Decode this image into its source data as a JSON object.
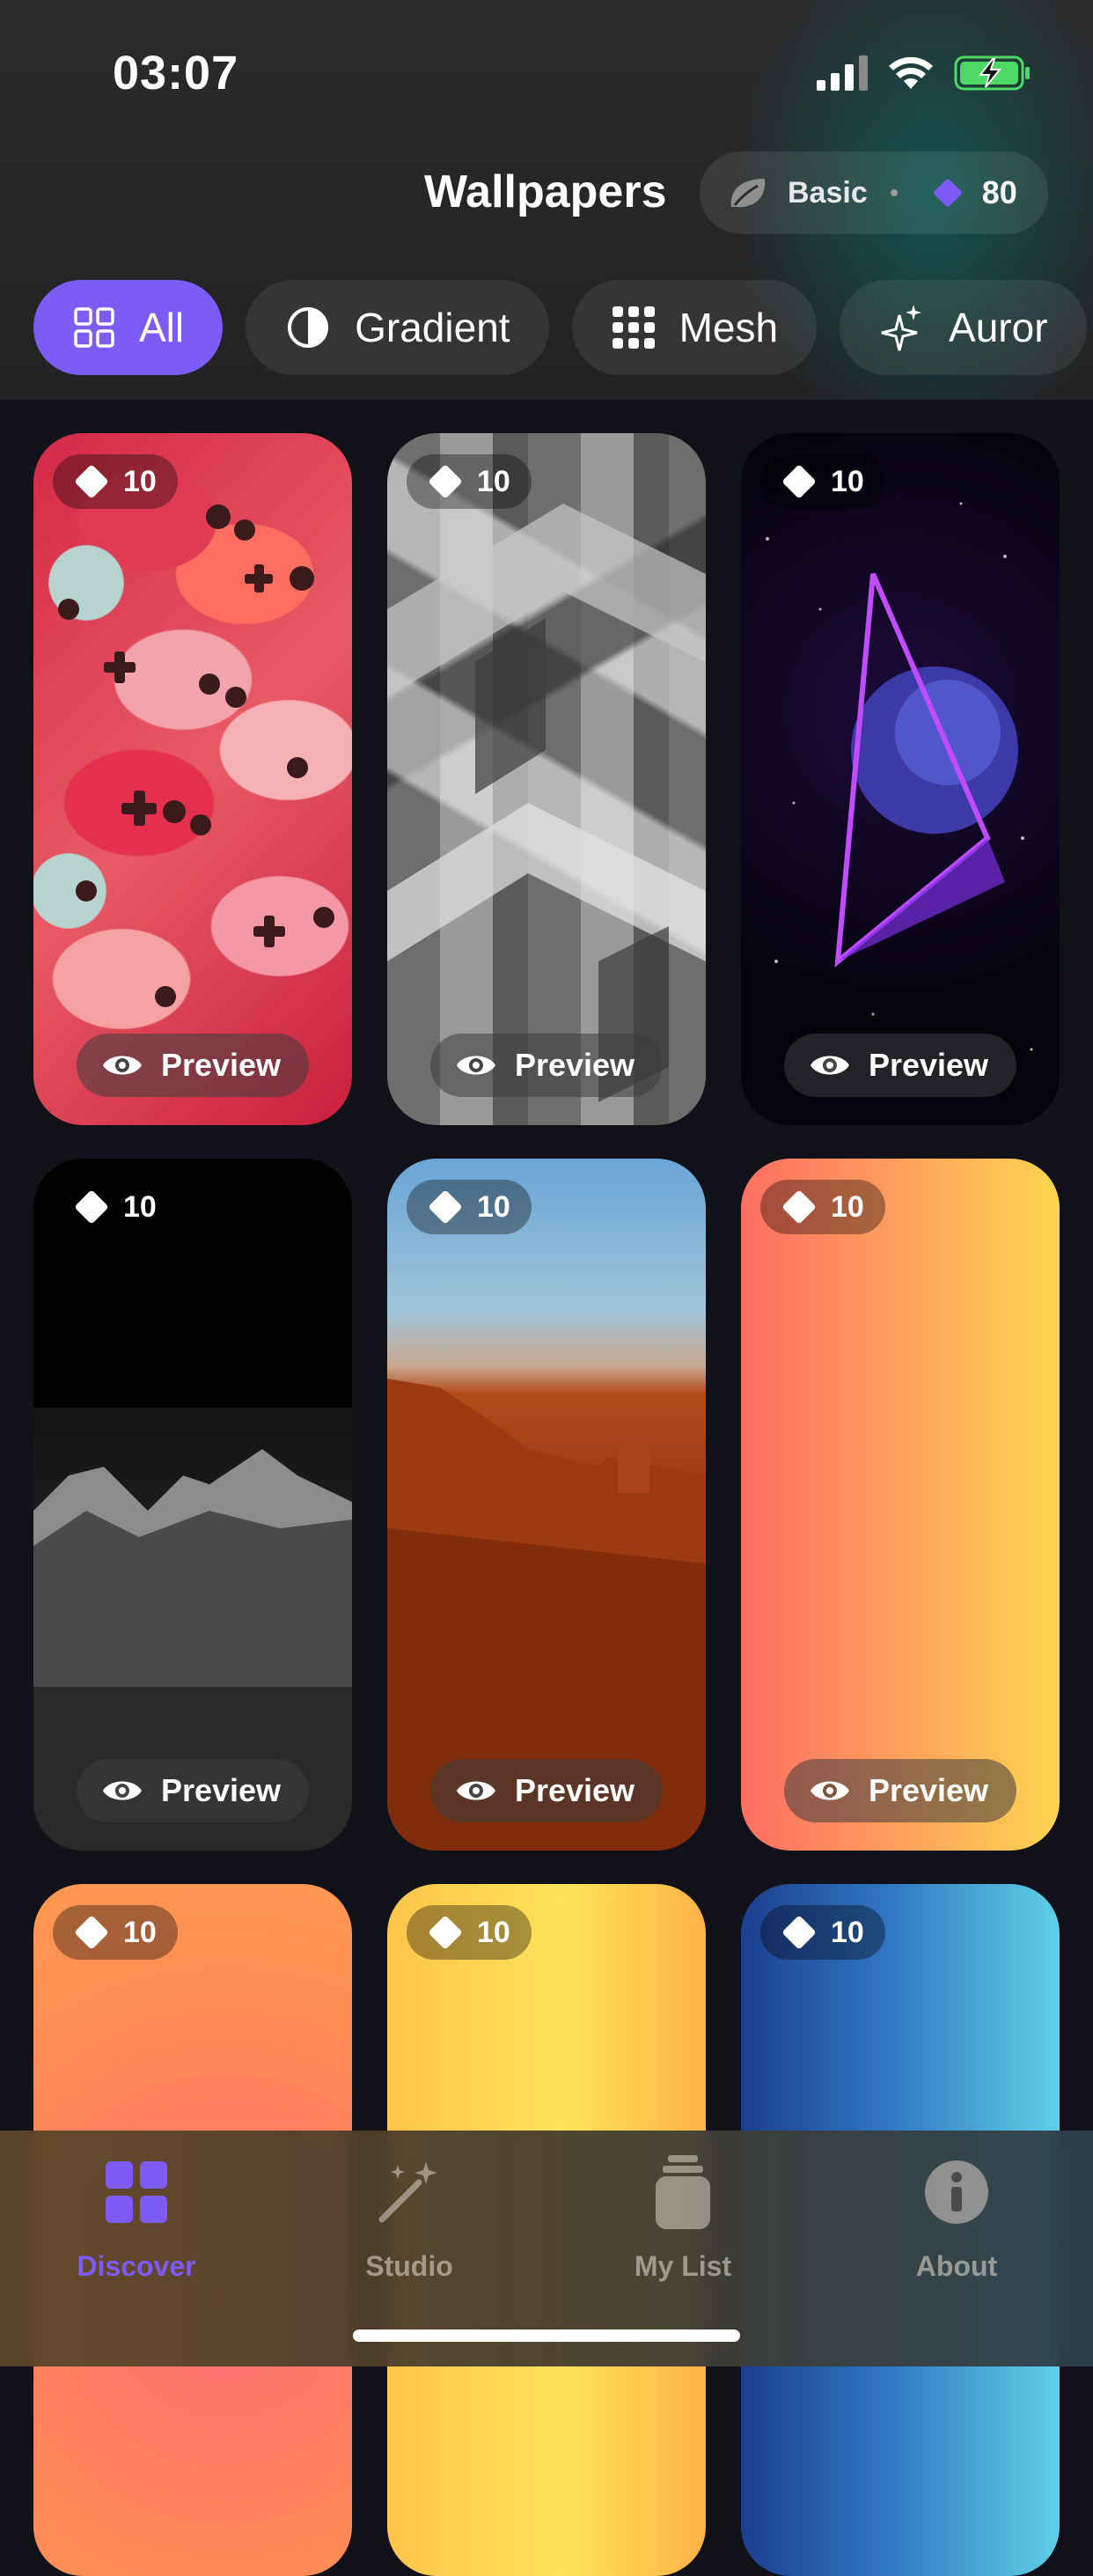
{
  "status_bar": {
    "time": "03:07"
  },
  "header": {
    "title": "Wallpapers",
    "plan": {
      "label": "Basic",
      "credits": "80"
    }
  },
  "filters": [
    {
      "label": "All",
      "icon": "grid-icon",
      "active": true
    },
    {
      "label": "Gradient",
      "icon": "half-circle-icon",
      "active": false
    },
    {
      "label": "Mesh",
      "icon": "dots-grid-icon",
      "active": false
    },
    {
      "label": "Auror",
      "icon": "sparkle-icon",
      "active": false
    }
  ],
  "cards": [
    {
      "price": "10",
      "preview_label": "Preview",
      "theme": "controllers"
    },
    {
      "price": "10",
      "preview_label": "Preview",
      "theme": "concrete"
    },
    {
      "price": "10",
      "preview_label": "Preview",
      "theme": "space"
    },
    {
      "price": "10",
      "preview_label": "Preview",
      "theme": "mountain"
    },
    {
      "price": "10",
      "preview_label": "Preview",
      "theme": "canyon"
    },
    {
      "price": "10",
      "preview_label": "Preview",
      "theme": "peach"
    },
    {
      "price": "10",
      "theme": "orange"
    },
    {
      "price": "10",
      "theme": "yellow"
    },
    {
      "price": "10",
      "theme": "blue"
    }
  ],
  "tabs": [
    {
      "label": "Discover",
      "icon": "grid-icon",
      "active": true
    },
    {
      "label": "Studio",
      "icon": "magic-wand-icon",
      "active": false
    },
    {
      "label": "My List",
      "icon": "jar-icon",
      "active": false
    },
    {
      "label": "About",
      "icon": "info-icon",
      "active": false
    }
  ],
  "colors": {
    "accent": "#7c5cf5",
    "background": "#111119"
  }
}
